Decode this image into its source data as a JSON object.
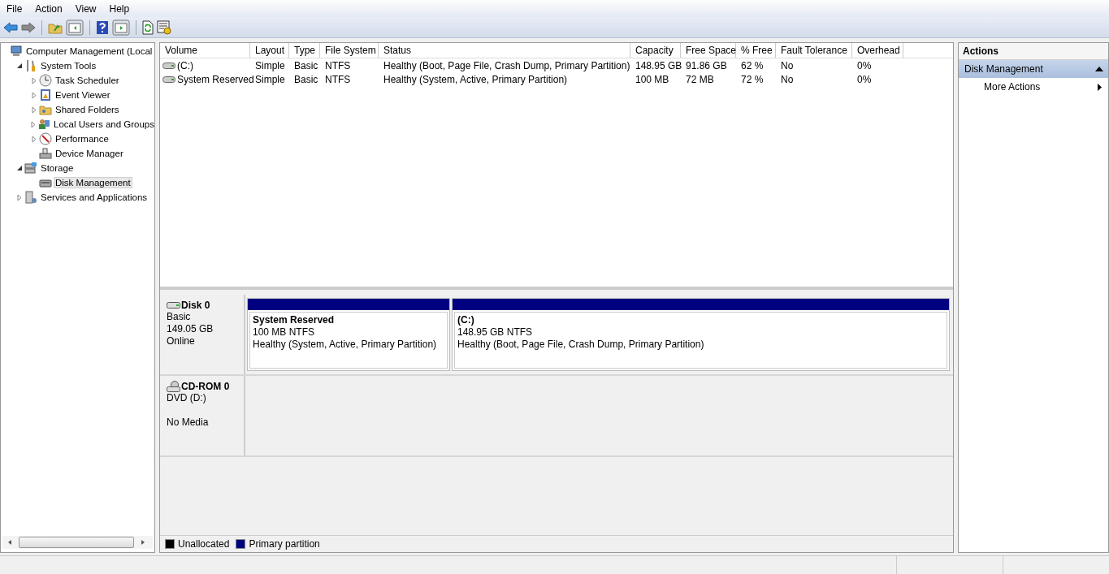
{
  "menu": [
    "File",
    "Action",
    "View",
    "Help"
  ],
  "tree": [
    {
      "label": "Computer Management (Local",
      "selected": false,
      "children": [
        {
          "label": "System Tools",
          "selected": false,
          "expanded": true,
          "children": [
            {
              "label": "Task Scheduler",
              "selected": false,
              "expanded": false
            },
            {
              "label": "Event Viewer",
              "selected": false,
              "expanded": false
            },
            {
              "label": "Shared Folders",
              "selected": false,
              "expanded": false
            },
            {
              "label": "Local Users and Groups",
              "selected": false,
              "expanded": false
            },
            {
              "label": "Performance",
              "selected": false,
              "expanded": false
            },
            {
              "label": "Device Manager",
              "selected": false
            }
          ]
        },
        {
          "label": "Storage",
          "selected": false,
          "expanded": true,
          "children": [
            {
              "label": "Disk Management",
              "selected": true
            }
          ]
        },
        {
          "label": "Services and Applications",
          "selected": false,
          "expanded": false
        }
      ]
    }
  ],
  "table": {
    "columns": [
      "Volume",
      "Layout",
      "Type",
      "File System",
      "Status",
      "Capacity",
      "Free Space",
      "% Free",
      "Fault Tolerance",
      "Overhead"
    ],
    "rows": [
      [
        "(C:)",
        "Simple",
        "Basic",
        "NTFS",
        "Healthy (Boot, Page File, Crash Dump, Primary Partition)",
        "148.95 GB",
        "91.86 GB",
        "62 %",
        "No",
        "0%"
      ],
      [
        "System Reserved",
        "Simple",
        "Basic",
        "NTFS",
        "Healthy (System, Active, Primary Partition)",
        "100 MB",
        "72 MB",
        "72 %",
        "No",
        "0%"
      ]
    ]
  },
  "disks": [
    {
      "kind": "disk",
      "name": "Disk 0",
      "lines": [
        "Basic",
        "149.05 GB",
        "Online"
      ],
      "partitions": [
        {
          "name": "System Reserved",
          "size": "100 MB NTFS",
          "status": "Healthy (System, Active, Primary Partition)",
          "color": "#000080"
        },
        {
          "name": "(C:)",
          "size": "148.95 GB NTFS",
          "status": "Healthy (Boot, Page File, Crash Dump, Primary Partition)",
          "color": "#000080"
        }
      ]
    },
    {
      "kind": "cdrom",
      "name": "CD-ROM 0",
      "lines": [
        "DVD (D:)",
        "No Media"
      ]
    }
  ],
  "legend": [
    {
      "label": "Unallocated",
      "color": "#000000"
    },
    {
      "label": "Primary partition",
      "color": "#000080"
    }
  ],
  "actions": {
    "title": "Actions",
    "section": "Disk Management",
    "expanded": true,
    "items": [
      "More Actions"
    ]
  }
}
